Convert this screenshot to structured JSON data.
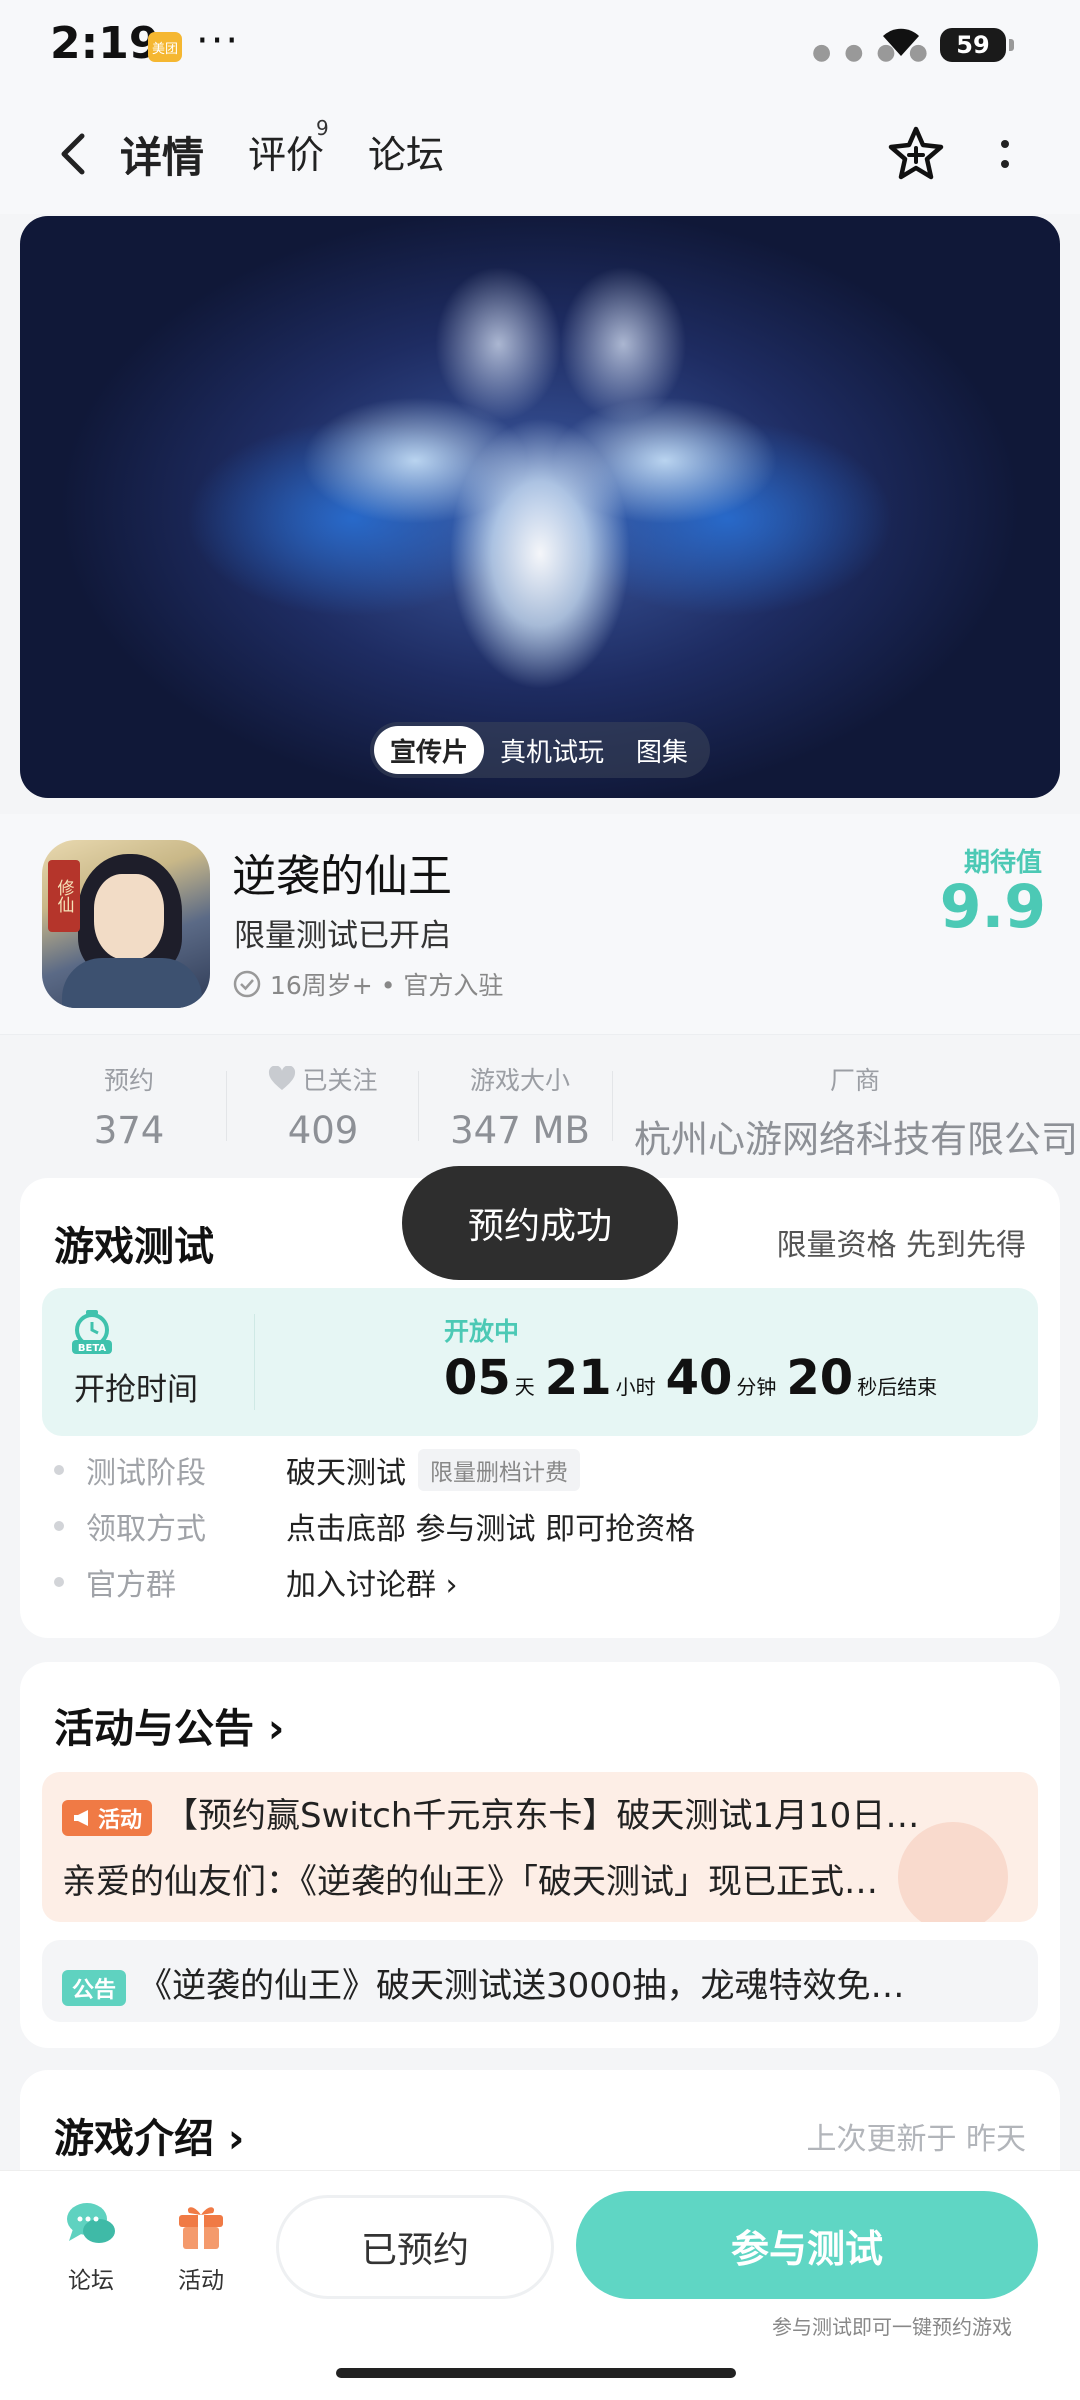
{
  "status_bar": {
    "time": "2:19",
    "app_badge": "美团",
    "more": "···",
    "battery": "59"
  },
  "nav": {
    "tabs": [
      {
        "label": "详情"
      },
      {
        "label": "评价"
      },
      {
        "label": "论坛"
      }
    ],
    "review_count": "9"
  },
  "hero": {
    "tabs": [
      {
        "label": "宣传片"
      },
      {
        "label": "真机试玩"
      },
      {
        "label": "图集"
      }
    ]
  },
  "game": {
    "title": "逆袭的仙王",
    "subtitle": "限量测试已开启",
    "meta": "16周岁+ • 官方入驻",
    "icon_seal": "修仙",
    "expect_label": "期待值",
    "expect_value": "9.9"
  },
  "stats": [
    {
      "label": "预约",
      "value": "374"
    },
    {
      "label": "已关注",
      "value": "409"
    },
    {
      "label": "游戏大小",
      "value": "347 MB"
    },
    {
      "label": "厂商",
      "value": "杭州心游网络科技有限公司"
    }
  ],
  "toast": "预约成功",
  "test": {
    "title": "游戏测试",
    "right_text": "限量资格 先到先得",
    "open_time_label": "开抢时间",
    "beta_badge": "BETA",
    "state": "开放中",
    "countdown": [
      {
        "num": "05",
        "unit": "天"
      },
      {
        "num": "21",
        "unit": "小时"
      },
      {
        "num": "40",
        "unit": "分钟"
      },
      {
        "num": "20",
        "unit": "秒后结束"
      }
    ],
    "rows": [
      {
        "key": "测试阶段",
        "value": "破天测试",
        "tag": "限量删档计费"
      },
      {
        "key": "领取方式",
        "value": "点击底部 参与测试 即可抢资格"
      },
      {
        "key": "官方群",
        "value": "加入讨论群 ›"
      }
    ]
  },
  "activity": {
    "title": "活动与公告 ›",
    "items": [
      {
        "badge": "活动",
        "title": "【预约赢Switch千元京东卡】破天测试1月10日…",
        "body": "亲爱的仙友们：《逆袭的仙王》「破天测试」现已正式…"
      },
      {
        "badge": "公告",
        "title": "《逆袭的仙王》破天测试送3000抽，龙魂特效免…"
      }
    ]
  },
  "intro": {
    "title": "游戏介绍 ›",
    "updated": "上次更新于 昨天"
  },
  "bottom": {
    "forum_label": "论坛",
    "activity_label": "活动",
    "reserved_label": "已预约",
    "join_label": "参与测试",
    "join_hint": "参与测试即可一键预约游戏"
  },
  "colors": {
    "accent": "#5fd6c4",
    "accent_text": "#4cc9b5",
    "orange": "#f07a45",
    "link": "#2d6bb8"
  }
}
